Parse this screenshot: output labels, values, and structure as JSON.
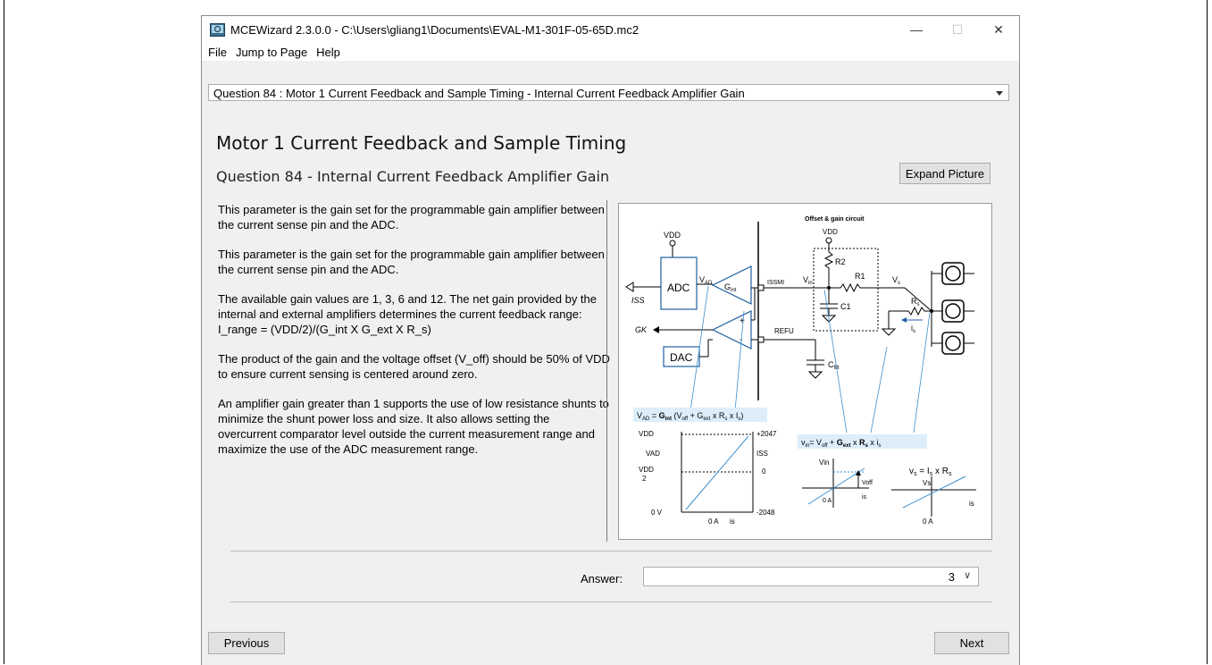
{
  "window": {
    "title": "MCEWizard 2.3.0.0  - C:\\Users\\gliang1\\Documents\\EVAL-M1-301F-05-65D.mc2",
    "controls": {
      "minimize": "—",
      "maximize": "☐",
      "close": "✕"
    }
  },
  "menu": {
    "file": "File",
    "jump": "Jump to Page",
    "help": "Help"
  },
  "question_selector": {
    "value": "Question  84 : Motor 1 Current Feedback and Sample Timing - Internal Current Feedback Amplifier Gain"
  },
  "page": {
    "heading": "Motor 1 Current Feedback and Sample Timing",
    "subheading": "Question 84 - Internal Current Feedback Amplifier Gain",
    "expand_button": "Expand Picture",
    "paragraphs": [
      "This parameter is the gain set for the programmable gain amplifier between the current sense pin and the ADC.",
      "This parameter is the gain set for the programmable gain amplifier between the current sense pin and the ADC.",
      "The available gain values are 1, 3, 6 and 12. The net gain provided by the internal and external amplifiers determines the current feedback range: I_range = (VDD/2)/(G_int X G_ext X R_s)",
      "The product of the gain and the voltage offset (V_off) should be 50% of VDD to ensure current sensing is centered around zero.",
      "An amplifier gain greater than 1 supports the use of low resistance shunts to minimize the shunt power loss and size. It also allows setting the overcurrent comparator level outside the current measurement range and maximize the use of the ADC measurement range."
    ]
  },
  "diagram": {
    "offset_title": "Offset & gain circuit",
    "vdd": "VDD",
    "adc": "ADC",
    "dac": "DAC",
    "vad": "V",
    "vad_sub": "AD",
    "gint": "G",
    "gint_sub": "int",
    "issmi": "ISSMI",
    "vin": "V",
    "vin_sub": "in",
    "r1": "R1",
    "r2": "R2",
    "c1": "C1",
    "vs": "V",
    "vs_sub": "s",
    "rs": "R",
    "rs_sub": "s",
    "is": "i",
    "is_sub": "s",
    "iss": "ISS",
    "gk": "GK",
    "refu": "REFU",
    "cfilt": "C",
    "cfilt_sub": "filt",
    "formula1": "V",
    "formula1_rest": "AD = Gint (Voff + Gext x Rs x Is)",
    "formula2": "vin= Voff + Gext x Rs x is",
    "formula3": "vs = Is x Rs",
    "g1": {
      "vdd": "VDD",
      "vad": "VAD",
      "vdd2": "VDD",
      "two": "2",
      "zero_v": "0 V",
      "zero_a": "0 A",
      "is": "is",
      "p2047": "+2047",
      "iss": "ISS",
      "zero": "0",
      "m2048": "-2048"
    },
    "g2": {
      "vin": "Vin",
      "voff": "Voff",
      "zero_a": "0 A",
      "is": "is"
    },
    "g3": {
      "vs": "Vs",
      "zero_a": "0 A",
      "is": "is"
    }
  },
  "answer": {
    "label": "Answer:",
    "value": "3",
    "chevron": "∨"
  },
  "nav": {
    "previous": "Previous",
    "next": "Next"
  }
}
